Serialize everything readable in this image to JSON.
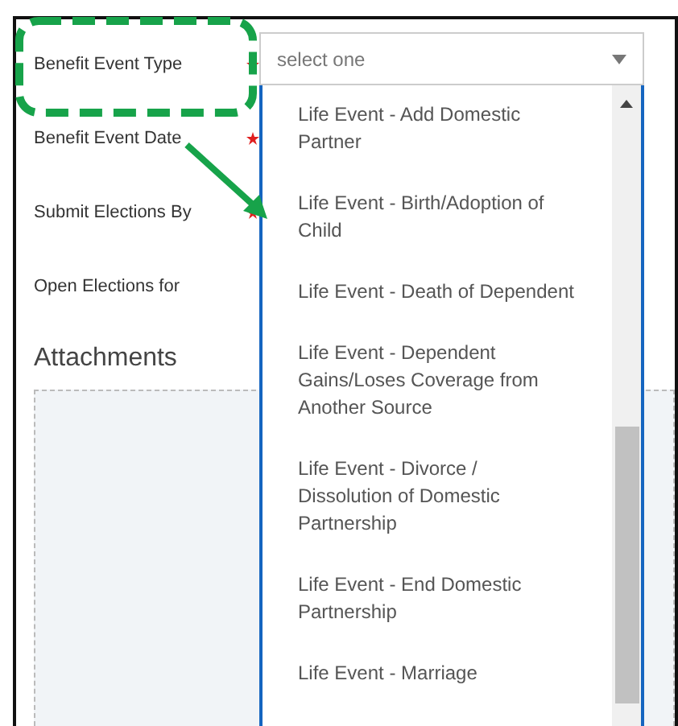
{
  "form": {
    "fields": [
      {
        "label": "Benefit Event Type",
        "required": true
      },
      {
        "label": "Benefit Event Date",
        "required": true
      },
      {
        "label": "Submit Elections By",
        "required": true
      },
      {
        "label": "Open Elections for",
        "required": false
      }
    ],
    "attachments": {
      "title": "Attachments"
    }
  },
  "dropdown": {
    "placeholder": "select one",
    "expanded": true,
    "options": [
      {
        "label": "Life Event - Add Domestic Partner",
        "selected": false
      },
      {
        "label": "Life Event - Birth/Adoption of Child",
        "selected": false
      },
      {
        "label": "Life Event - Death of Dependent",
        "selected": false
      },
      {
        "label": "Life Event - Dependent Gains/Loses Coverage from Another Source",
        "selected": false
      },
      {
        "label": "Life Event - Divorce / Dissolution of Domestic Partnership",
        "selected": false
      },
      {
        "label": "Life Event - End Domestic Partnership",
        "selected": false
      },
      {
        "label": "Life Event - Marriage",
        "selected": false
      }
    ]
  }
}
